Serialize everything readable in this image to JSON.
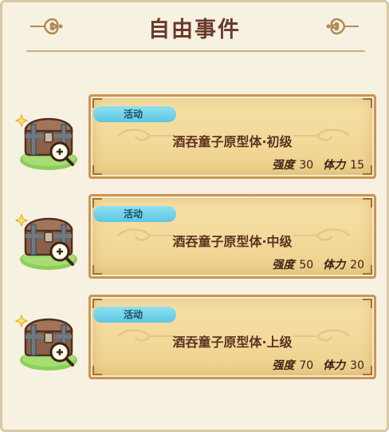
{
  "title": "自由事件",
  "events": [
    {
      "tag": "活动",
      "name": "酒吞童子原型体·初级",
      "strength_label": "强度",
      "strength": "30",
      "stamina_label": "体力",
      "stamina": "15"
    },
    {
      "tag": "活动",
      "name": "酒吞童子原型体·中级",
      "strength_label": "强度",
      "strength": "50",
      "stamina_label": "体力",
      "stamina": "20"
    },
    {
      "tag": "活动",
      "name": "酒吞童子原型体·上级",
      "strength_label": "强度",
      "strength": "70",
      "stamina_label": "体力",
      "stamina": "30"
    }
  ],
  "colors": {
    "panel_bg": "#f7f1e2",
    "title_text": "#6b3a2a",
    "card_bg": "#f3d99a",
    "card_border": "#c9955a",
    "tag_bg": "#5cc6e2"
  },
  "icons": [
    "ornament-scroll-icon",
    "treasure-chest-icon",
    "magnifier-icon",
    "sparkle-icon"
  ]
}
